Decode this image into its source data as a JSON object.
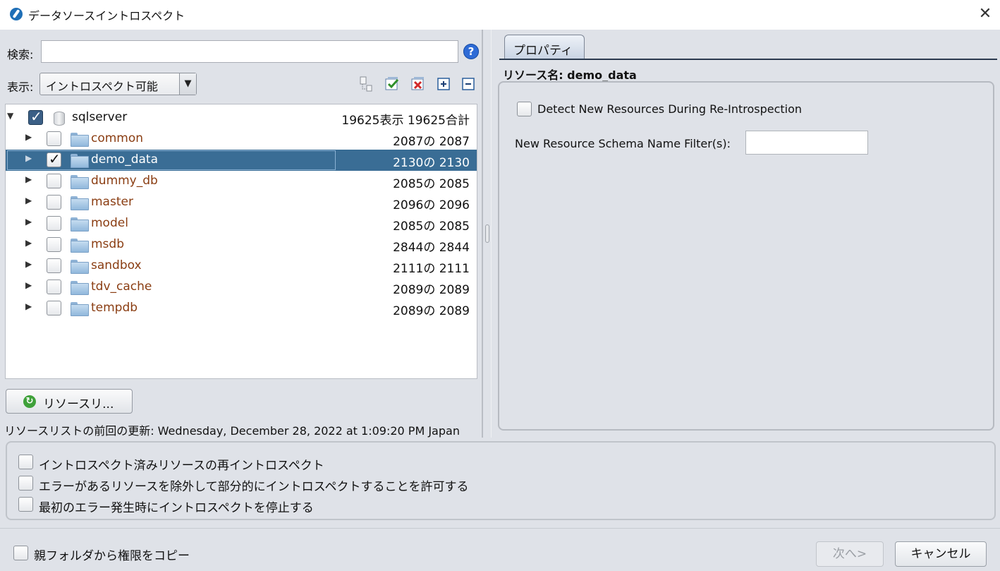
{
  "window": {
    "title": "データソースイントロスペクト",
    "close_label": "✕"
  },
  "left": {
    "search_label": "検索:",
    "search_value": "",
    "help_label": "?",
    "display_label": "表示:",
    "display_value": "イントロスペクト可能",
    "tree": {
      "root": {
        "name": "sqlserver",
        "count": "19625表示 19625合計",
        "checked": true
      },
      "children": [
        {
          "name": "common",
          "count": "2087の 2087",
          "checked": false,
          "selected": false
        },
        {
          "name": "demo_data",
          "count": "2130の 2130",
          "checked": true,
          "selected": true
        },
        {
          "name": "dummy_db",
          "count": "2085の 2085",
          "checked": false,
          "selected": false
        },
        {
          "name": "master",
          "count": "2096の 2096",
          "checked": false,
          "selected": false
        },
        {
          "name": "model",
          "count": "2085の 2085",
          "checked": false,
          "selected": false
        },
        {
          "name": "msdb",
          "count": "2844の 2844",
          "checked": false,
          "selected": false
        },
        {
          "name": "sandbox",
          "count": "2111の 2111",
          "checked": false,
          "selected": false
        },
        {
          "name": "tdv_cache",
          "count": "2089の 2089",
          "checked": false,
          "selected": false
        },
        {
          "name": "tempdb",
          "count": "2089の 2089",
          "checked": false,
          "selected": false
        }
      ]
    },
    "refresh_button": "リソースリ...",
    "last_update": "リソースリストの前回の更新: Wednesday, December 28, 2022 at 1:09:20 PM Japan"
  },
  "right": {
    "tab_label": "プロパティ",
    "resource_name": "リソース名: demo_data",
    "detect_label": "Detect New Resources During Re-Introspection",
    "filter_label": "New Resource Schema Name Filter(s):",
    "filter_value": ""
  },
  "options": [
    {
      "label": "イントロスペクト済みリソースの再イントロスペクト",
      "checked": false
    },
    {
      "label": "エラーがあるリソースを除外して部分的にイントロスペクトすることを許可する",
      "checked": false
    },
    {
      "label": "最初のエラー発生時にイントロスペクトを停止する",
      "checked": false
    }
  ],
  "footer": {
    "copy_label": "親フォルダから権限をコピー",
    "next_button": "次へ>",
    "cancel_button": "キャンセル"
  },
  "colors": {
    "selected_row": "#3a6d95",
    "node_text": "#8a3d12",
    "dialog_bg": "#dfe2e8"
  }
}
